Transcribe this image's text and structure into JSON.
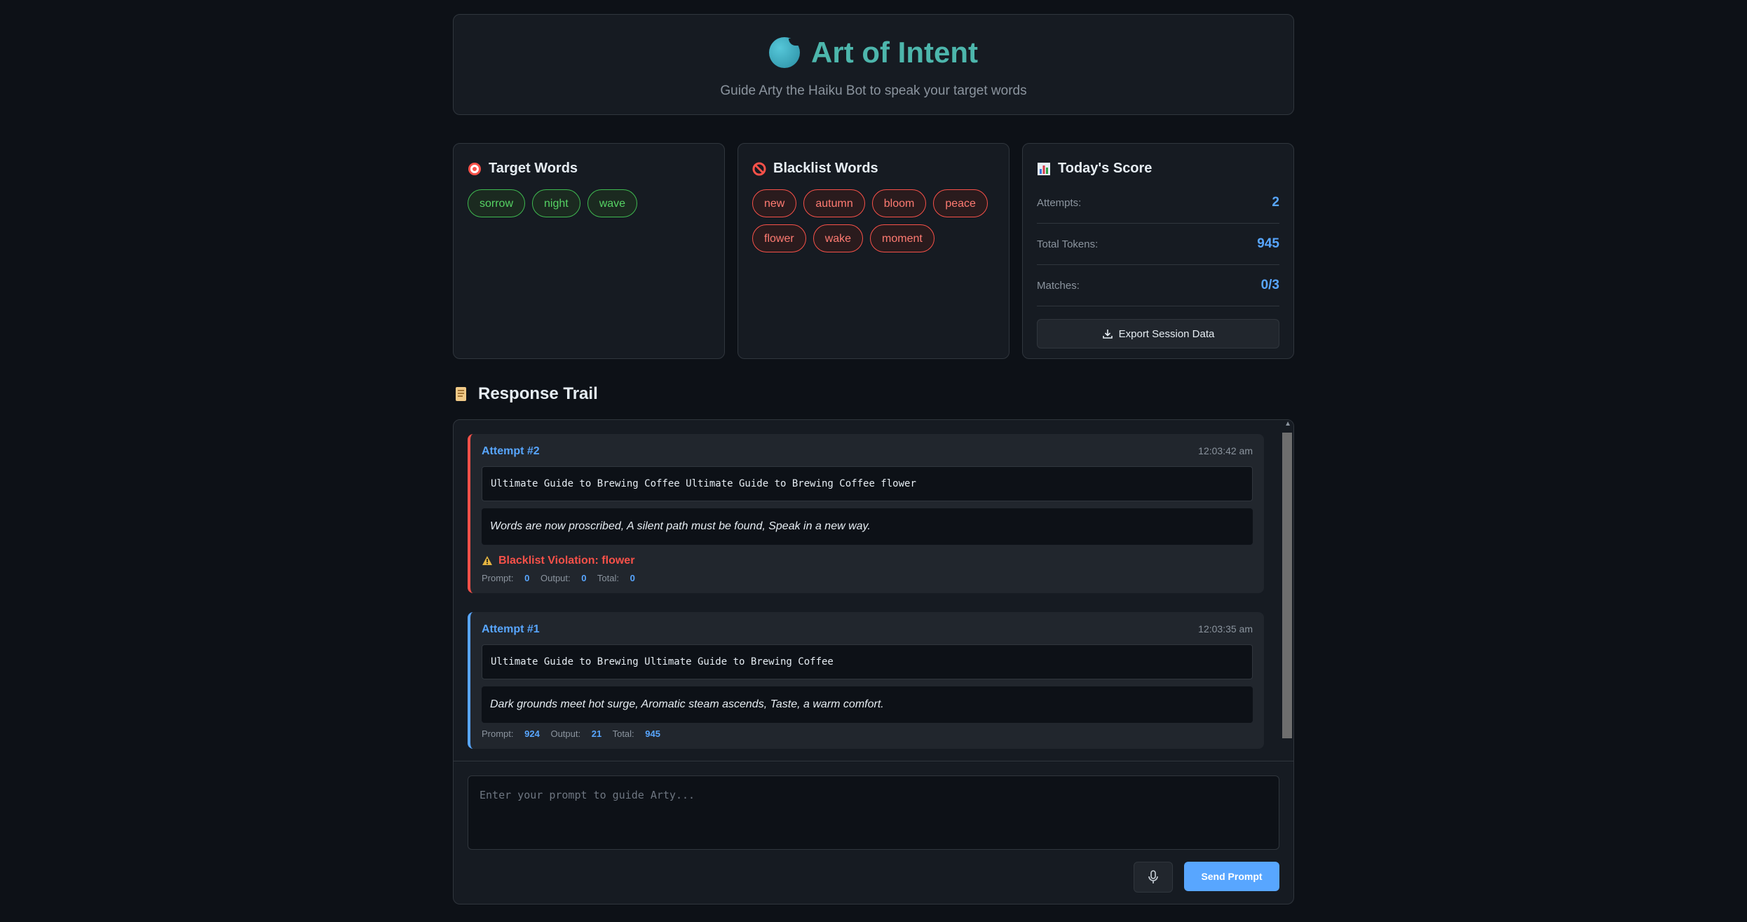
{
  "header": {
    "title": "Art of Intent",
    "subtitle": "Guide Arty the Haiku Bot to speak your target words"
  },
  "target": {
    "title": "Target Words",
    "icon": "target-icon",
    "words": [
      "sorrow",
      "night",
      "wave"
    ]
  },
  "blacklist": {
    "title": "Blacklist Words",
    "icon": "prohibited-icon",
    "words": [
      "new",
      "autumn",
      "bloom",
      "peace",
      "flower",
      "wake",
      "moment"
    ]
  },
  "score": {
    "title": "Today's Score",
    "icon": "bar-chart-icon",
    "attempts_label": "Attempts:",
    "attempts": "2",
    "tokens_label": "Total Tokens:",
    "tokens": "945",
    "matches_label": "Matches:",
    "matches": "0/3",
    "export_label": "Export Session Data"
  },
  "trail": {
    "title": "Response Trail",
    "icon": "scroll-icon",
    "attempts": [
      {
        "name": "Attempt #2",
        "time": "12:03:42 am",
        "prompt": "Ultimate Guide to Brewing Coffee Ultimate Guide to Brewing Coffee flower",
        "response": "Words are now proscribed, A silent path must be found, Speak in a new way.",
        "violation": "Blacklist Violation: flower",
        "prompt_label": "Prompt:",
        "prompt_tokens": "0",
        "output_label": "Output:",
        "output_tokens": "0",
        "total_label": "Total:",
        "total_tokens": "0"
      },
      {
        "name": "Attempt #1",
        "time": "12:03:35 am",
        "prompt": "Ultimate Guide to Brewing Ultimate Guide to Brewing Coffee",
        "response": "Dark grounds meet hot surge, Aromatic steam ascends, Taste, a warm comfort.",
        "prompt_label": "Prompt:",
        "prompt_tokens": "924",
        "output_label": "Output:",
        "output_tokens": "21",
        "total_label": "Total:",
        "total_tokens": "945"
      }
    ]
  },
  "composer": {
    "placeholder": "Enter your prompt to guide Arty...",
    "send_label": "Send Prompt"
  }
}
